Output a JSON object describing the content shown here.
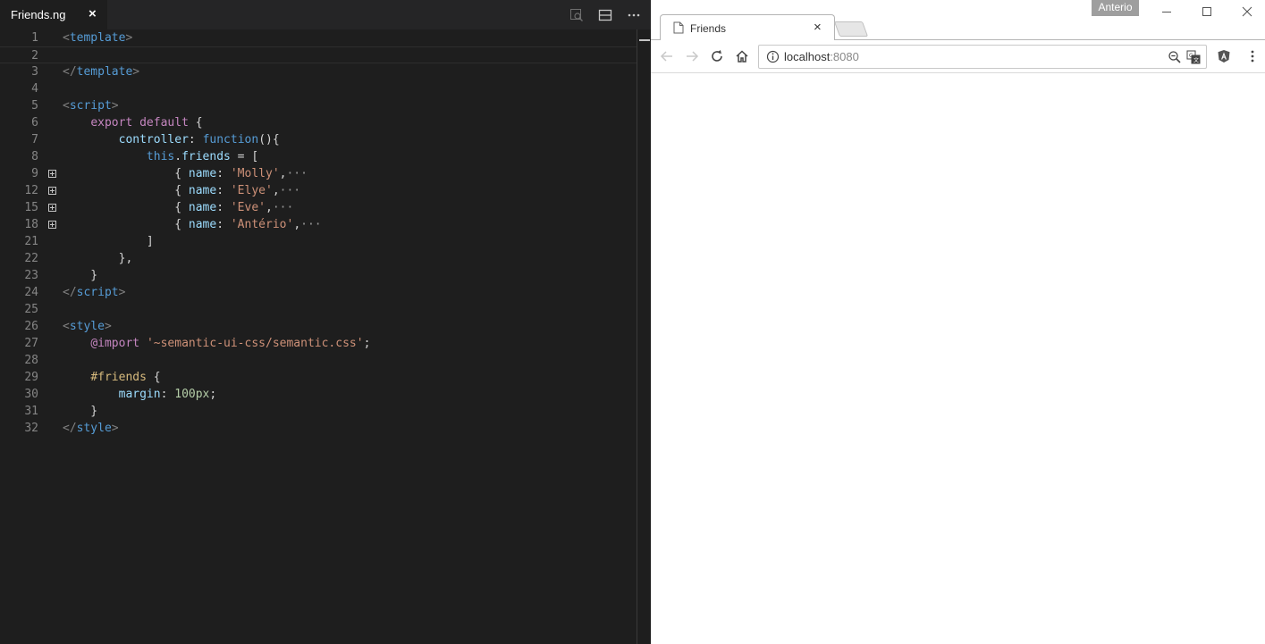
{
  "editor": {
    "tab": {
      "title": "Friends.ng",
      "close": "×"
    },
    "actions": [
      "open-preview-icon",
      "split-editor-icon",
      "more-actions-icon"
    ],
    "lines": [
      {
        "n": "1",
        "tokens": [
          [
            "t-brk",
            "<"
          ],
          [
            "t-tag",
            "template"
          ],
          [
            "t-brk",
            ">"
          ]
        ]
      },
      {
        "n": "2",
        "tokens": [],
        "current": true
      },
      {
        "n": "3",
        "tokens": [
          [
            "t-brk",
            "</"
          ],
          [
            "t-tag",
            "template"
          ],
          [
            "t-brk",
            ">"
          ]
        ]
      },
      {
        "n": "4",
        "tokens": []
      },
      {
        "n": "5",
        "tokens": [
          [
            "t-brk",
            "<"
          ],
          [
            "t-tag",
            "script"
          ],
          [
            "t-brk",
            ">"
          ]
        ]
      },
      {
        "n": "6",
        "tokens": [
          [
            "t-plain",
            "    "
          ],
          [
            "t-kw",
            "export"
          ],
          [
            "t-plain",
            " "
          ],
          [
            "t-kw",
            "default"
          ],
          [
            "t-plain",
            " {"
          ]
        ]
      },
      {
        "n": "7",
        "tokens": [
          [
            "t-plain",
            "        "
          ],
          [
            "t-prop",
            "controller"
          ],
          [
            "t-plain",
            ": "
          ],
          [
            "t-fn",
            "function"
          ],
          [
            "t-plain",
            "(){"
          ]
        ]
      },
      {
        "n": "8",
        "tokens": [
          [
            "t-plain",
            "            "
          ],
          [
            "t-fn",
            "this"
          ],
          [
            "t-plain",
            "."
          ],
          [
            "t-prop",
            "friends"
          ],
          [
            "t-plain",
            " = ["
          ]
        ]
      },
      {
        "n": "9",
        "fold": true,
        "tokens": [
          [
            "t-plain",
            "                { "
          ],
          [
            "t-prop",
            "name"
          ],
          [
            "t-plain",
            ": "
          ],
          [
            "t-str",
            "'Molly'"
          ],
          [
            "t-plain",
            ","
          ],
          [
            "t-ell",
            "···"
          ]
        ]
      },
      {
        "n": "12",
        "fold": true,
        "tokens": [
          [
            "t-plain",
            "                { "
          ],
          [
            "t-prop",
            "name"
          ],
          [
            "t-plain",
            ": "
          ],
          [
            "t-str",
            "'Elye'"
          ],
          [
            "t-plain",
            ","
          ],
          [
            "t-ell",
            "···"
          ]
        ]
      },
      {
        "n": "15",
        "fold": true,
        "tokens": [
          [
            "t-plain",
            "                { "
          ],
          [
            "t-prop",
            "name"
          ],
          [
            "t-plain",
            ": "
          ],
          [
            "t-str",
            "'Eve'"
          ],
          [
            "t-plain",
            ","
          ],
          [
            "t-ell",
            "···"
          ]
        ]
      },
      {
        "n": "18",
        "fold": true,
        "tokens": [
          [
            "t-plain",
            "                { "
          ],
          [
            "t-prop",
            "name"
          ],
          [
            "t-plain",
            ": "
          ],
          [
            "t-str",
            "'Antério'"
          ],
          [
            "t-plain",
            ","
          ],
          [
            "t-ell",
            "···"
          ]
        ]
      },
      {
        "n": "21",
        "tokens": [
          [
            "t-plain",
            "            ]"
          ]
        ]
      },
      {
        "n": "22",
        "tokens": [
          [
            "t-plain",
            "        },"
          ]
        ]
      },
      {
        "n": "23",
        "tokens": [
          [
            "t-plain",
            "    }"
          ]
        ]
      },
      {
        "n": "24",
        "tokens": [
          [
            "t-brk",
            "</"
          ],
          [
            "t-tag",
            "script"
          ],
          [
            "t-brk",
            ">"
          ]
        ]
      },
      {
        "n": "25",
        "tokens": []
      },
      {
        "n": "26",
        "tokens": [
          [
            "t-brk",
            "<"
          ],
          [
            "t-tag",
            "style"
          ],
          [
            "t-brk",
            ">"
          ]
        ]
      },
      {
        "n": "27",
        "tokens": [
          [
            "t-plain",
            "    "
          ],
          [
            "t-kw",
            "@import"
          ],
          [
            "t-plain",
            " "
          ],
          [
            "t-str",
            "'~semantic-ui-css/semantic.css'"
          ],
          [
            "t-plain",
            ";"
          ]
        ]
      },
      {
        "n": "28",
        "tokens": []
      },
      {
        "n": "29",
        "tokens": [
          [
            "t-plain",
            "    "
          ],
          [
            "t-sel",
            "#friends"
          ],
          [
            "t-plain",
            " {"
          ]
        ]
      },
      {
        "n": "30",
        "tokens": [
          [
            "t-plain",
            "        "
          ],
          [
            "t-prop",
            "margin"
          ],
          [
            "t-plain",
            ": "
          ],
          [
            "t-num",
            "100px"
          ],
          [
            "t-plain",
            ";"
          ]
        ]
      },
      {
        "n": "31",
        "tokens": [
          [
            "t-plain",
            "    }"
          ]
        ]
      },
      {
        "n": "32",
        "tokens": [
          [
            "t-brk",
            "</"
          ],
          [
            "t-tag",
            "style"
          ],
          [
            "t-brk",
            ">"
          ]
        ]
      }
    ]
  },
  "browser": {
    "user": "Anterio",
    "tab": {
      "title": "Friends",
      "close": "×"
    },
    "url": {
      "host": "localhost",
      "port": ":8080"
    },
    "toolbar_icons": [
      "back-icon",
      "forward-icon",
      "reload-icon",
      "home-icon"
    ],
    "colors": {
      "editor_bg": "#1e1e1e",
      "page_bg": "#ffffff"
    }
  }
}
